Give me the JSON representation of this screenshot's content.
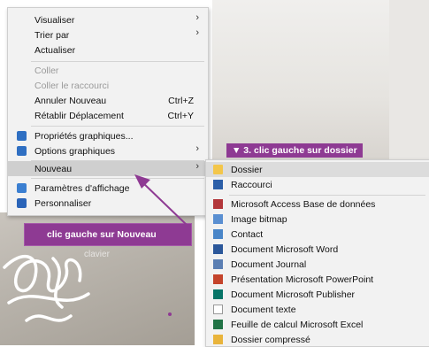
{
  "context_menu": {
    "visualiser": "Visualiser",
    "trier_par": "Trier par",
    "actualiser": "Actualiser",
    "coller": "Coller",
    "coller_raccourci": "Coller le raccourci",
    "annuler": "Annuler Nouveau",
    "annuler_shortcut": "Ctrl+Z",
    "retablir": "Rétablir Déplacement",
    "retablir_shortcut": "Ctrl+Y",
    "proprietes_graphiques": "Propriétés graphiques...",
    "options_graphiques": "Options graphiques",
    "nouveau": "Nouveau",
    "parametres_affichage": "Paramètres d'affichage",
    "personnaliser": "Personnaliser"
  },
  "submenu": {
    "items": [
      "Dossier",
      "Raccourci",
      "Microsoft Access Base de données",
      "Image bitmap",
      "Contact",
      "Document Microsoft Word",
      "Document Journal",
      "Présentation Microsoft PowerPoint",
      "Document Microsoft Publisher",
      "Document texte",
      "Feuille de calcul Microsoft Excel",
      "Dossier compressé"
    ]
  },
  "annotations": {
    "step3": "▼ 3. clic gauche sur dossier",
    "step_nouveau": "clic gauche sur Nouveau",
    "faint_text": "clavier"
  },
  "colors": {
    "accent": "#8e3a93",
    "menu_bg": "#f2f2f2"
  }
}
